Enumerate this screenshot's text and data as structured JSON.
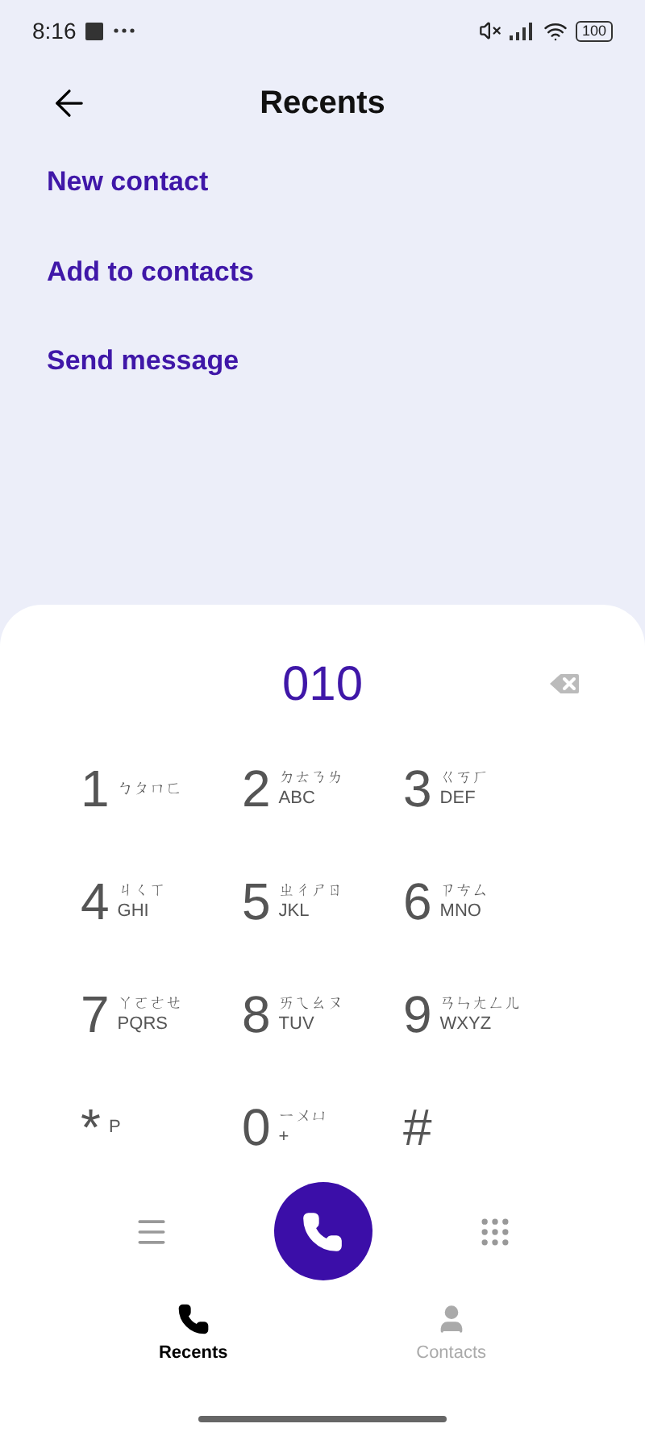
{
  "status_bar": {
    "time": "8:16",
    "battery": "100"
  },
  "header": {
    "title": "Recents"
  },
  "actions": [
    "New contact",
    "Add to contacts",
    "Send message"
  ],
  "dialer": {
    "number": "010",
    "keys": [
      {
        "digit": "1",
        "zhuyin": "ㄅㄆㄇㄈ"
      },
      {
        "digit": "2",
        "zhuyin": "ㄉㄊㄋㄌ",
        "letters": "ABC"
      },
      {
        "digit": "3",
        "zhuyin": "ㄍㄎㄏ",
        "letters": "DEF"
      },
      {
        "digit": "4",
        "zhuyin": "ㄐㄑㄒ",
        "letters": "GHI"
      },
      {
        "digit": "5",
        "zhuyin": "ㄓㄔㄕㄖ",
        "letters": "JKL"
      },
      {
        "digit": "6",
        "zhuyin": "ㄗㄘㄙ",
        "letters": "MNO"
      },
      {
        "digit": "7",
        "zhuyin": "ㄚㄛㄜㄝ",
        "letters": "PQRS"
      },
      {
        "digit": "8",
        "zhuyin": "ㄞㄟㄠㄡ",
        "letters": "TUV"
      },
      {
        "digit": "9",
        "zhuyin": "ㄢㄣㄤㄥㄦ",
        "letters": "WXYZ"
      },
      {
        "digit": "*",
        "letters": "P"
      },
      {
        "digit": "0",
        "zhuyin": "ㄧㄨㄩ",
        "letters": "+"
      },
      {
        "digit": "#"
      }
    ]
  },
  "tabs": [
    {
      "label": "Recents",
      "selected": true
    },
    {
      "label": "Contacts",
      "selected": false
    }
  ]
}
